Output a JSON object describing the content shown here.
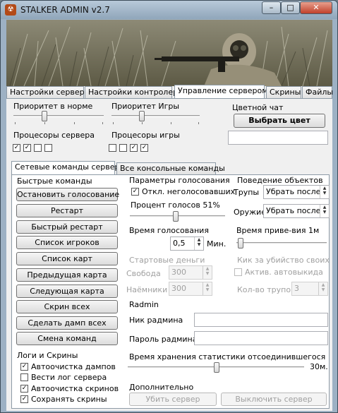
{
  "window": {
    "title": "STALKER ADMIN v2.7",
    "icon": "app-icon"
  },
  "main_tabs": [
    {
      "label": "Настройки сервера"
    },
    {
      "label": "Настройки контролера"
    },
    {
      "label": "Управление сервером"
    },
    {
      "label": "Скрины"
    },
    {
      "label": "Файлы"
    }
  ],
  "top": {
    "priority_normal": "Приоритет в норме",
    "priority_game": "Приоритет Игры",
    "server_cpus": "Процесоры сервера",
    "game_cpus": "Процесоры игры",
    "server_cpu_checks": [
      true,
      true,
      false,
      false
    ],
    "game_cpu_checks": [
      false,
      false,
      true,
      true
    ],
    "priority_normal_level": 0.25,
    "priority_game_level": 0.25,
    "color_chat": "Цветной чат",
    "choose_color": "Выбрать цвет",
    "color_value": ""
  },
  "sub_tabs": [
    {
      "label": "Сетевые команды сервера"
    },
    {
      "label": "Все консольные команды"
    }
  ],
  "quick": {
    "title": "Быстрые команды",
    "buttons": [
      "Остановить голосование",
      "Рестарт",
      "Быстрый рестарт",
      "Список игроков",
      "Список карт",
      "Предыдущая карта",
      "Следующая карта",
      "Скрин всех",
      "Сделать дамп всех",
      "Смена команд"
    ]
  },
  "logs": {
    "title": "Логи и Скрины",
    "items": [
      {
        "label": "Автоочистка дампов",
        "checked": true
      },
      {
        "label": "Вести лог сервера",
        "checked": false
      },
      {
        "label": "Автоочистка скринов",
        "checked": true
      },
      {
        "label": "Сохранять скрины",
        "checked": true
      }
    ]
  },
  "vote": {
    "title": "Параметры голосования",
    "disable_label": "Откл. неголосовавших",
    "disable_checked": true,
    "percent_label": "Процент голосов 51%",
    "percent_value": 51,
    "time_label": "Время голосования",
    "time_value": "0,5",
    "time_unit": "Мин."
  },
  "objects": {
    "title": "Поведение объектов",
    "corpses_label": "Трупы",
    "corpses_value": "Убрать после",
    "weapon_label": "Оружие",
    "weapon_value": "Убрать после",
    "respawn_label": "Время приве-вия 1м",
    "respawn_level": 0.0
  },
  "money": {
    "title": "Стартовые деньги",
    "freedom_label": "Свобода",
    "freedom_value": "300",
    "merc_label": "Наёмники",
    "merc_value": "300"
  },
  "kick": {
    "title": "Кик за убийство своих",
    "auto_label": "Актив. автовыкида",
    "auto_checked": false,
    "count_label": "Кол-во трупов",
    "count_value": "3"
  },
  "radmin": {
    "title": "Radmin",
    "nick_label": "Ник радмина",
    "nick_value": "",
    "pass_label": "Пароль радмина",
    "pass_value": ""
  },
  "stats": {
    "label": "Время хранения статистики отсоединившегося",
    "value_text": "30м.",
    "level": 0.48
  },
  "extra": {
    "title": "Дополнительно",
    "kill_server": "Убить сервер",
    "shutdown_server": "Выключить сервер"
  },
  "colors": {
    "title_bar": "#9db1c4",
    "close": "#c0402a"
  }
}
